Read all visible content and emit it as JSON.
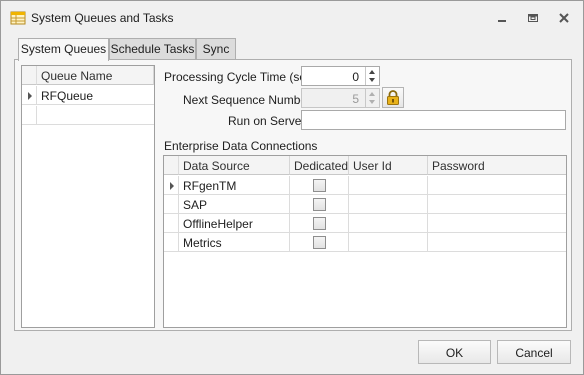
{
  "window": {
    "title": "System Queues and Tasks",
    "icons": {
      "app": "table-app-icon",
      "minimize": "minimize-icon",
      "restore": "restore-icon",
      "close": "close-icon"
    }
  },
  "tabs": [
    {
      "label": "System Queues",
      "active": true
    },
    {
      "label": "Schedule Tasks",
      "active": false
    },
    {
      "label": "Sync",
      "active": false
    }
  ],
  "queue_grid": {
    "column": "Queue Name",
    "rows": [
      {
        "name": "RFQueue",
        "current": true
      }
    ]
  },
  "form": {
    "processing_cycle_label": "Processing Cycle Time (sec)",
    "processing_cycle_value": "0",
    "next_sequence_label": "Next Sequence Number",
    "next_sequence_value": "5",
    "run_on_server_label": "Run on Server",
    "run_on_server_value": "",
    "lock_icon": "padlock-icon"
  },
  "connections": {
    "section_label": "Enterprise Data Connections",
    "columns": [
      "Data Source",
      "Dedicated",
      "User Id",
      "Password"
    ],
    "rows": [
      {
        "data_source": "RFgenTM",
        "dedicated": false,
        "user_id": "",
        "password": "",
        "current": true
      },
      {
        "data_source": "SAP",
        "dedicated": false,
        "user_id": "",
        "password": ""
      },
      {
        "data_source": "OfflineHelper",
        "dedicated": false,
        "user_id": "",
        "password": ""
      },
      {
        "data_source": "Metrics",
        "dedicated": false,
        "user_id": "",
        "password": ""
      }
    ]
  },
  "footer": {
    "ok_label": "OK",
    "cancel_label": "Cancel"
  }
}
